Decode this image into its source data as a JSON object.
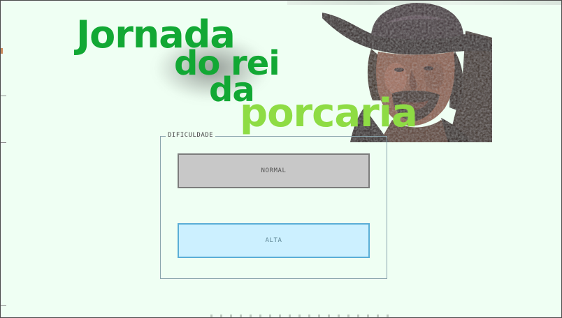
{
  "title": {
    "line1": "Jornada",
    "line2": "do rei",
    "line3": "da",
    "line4": "porcaria"
  },
  "portrait": {
    "icon": "cowboy-portrait-image"
  },
  "difficulty": {
    "legend": "DIFICULDADE",
    "normal_label": "NORMAL",
    "alta_label": "ALTA"
  },
  "colors": {
    "background": "#effff3",
    "title_dark_green": "#12a834",
    "title_light_green": "#8edc44",
    "normal_button": "#c8c8c8",
    "alta_button": "#ccf0ff",
    "alta_border": "#5aaed6"
  }
}
